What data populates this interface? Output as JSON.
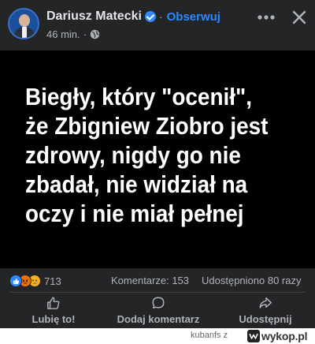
{
  "author": {
    "name": "Dariusz Matecki",
    "verified": true,
    "separator": "·",
    "follow_label": "Obserwuj",
    "time": "46 min.",
    "meta_separator": "·",
    "visibility_icon": "globe-icon"
  },
  "header_controls": {
    "more_icon": "more-horizontal-icon",
    "close_icon": "close-icon"
  },
  "post": {
    "text": "Biegły, który \"ocenił\",\nże Zbigniew Ziobro jest\nzdrowy, nigdy go nie\nzbadał, nie widział na\noczy i nie miał pełnej",
    "background": "#000000",
    "text_color": "#ffffff"
  },
  "stats": {
    "reactions": [
      "like",
      "angry",
      "sad"
    ],
    "reaction_count": "713",
    "comments": "Komentarze: 153",
    "shares": "Udostępniono 80 razy"
  },
  "actions": {
    "like_label": "Lubię to!",
    "comment_label": "Dodaj komentarz",
    "share_label": "Udostępnij"
  },
  "footer": {
    "user": "kubanfs",
    "connector": "z",
    "site": "wykop.pl"
  },
  "colors": {
    "surface": "#242526",
    "accent": "#2d88ff",
    "secondary_text": "#b0b3b8"
  }
}
